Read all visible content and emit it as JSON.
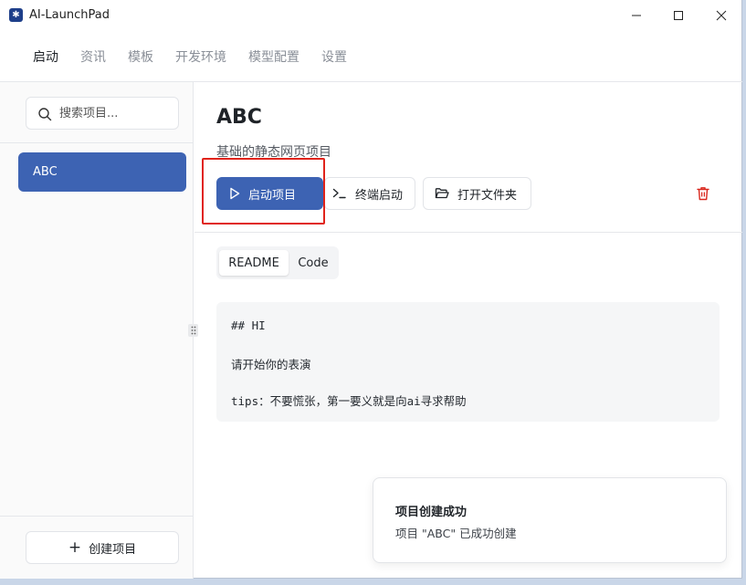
{
  "app": {
    "title": "AI-LaunchPad",
    "icon": "app-logo-icon"
  },
  "window_controls": [
    "minimize-icon",
    "maximize-icon",
    "close-icon"
  ],
  "menu": {
    "items": [
      {
        "label": "启动",
        "active": true
      },
      {
        "label": "资讯"
      },
      {
        "label": "模板"
      },
      {
        "label": "开发环境"
      },
      {
        "label": "模型配置"
      },
      {
        "label": "设置"
      }
    ]
  },
  "sidebar": {
    "search": {
      "placeholder": "搜索项目...",
      "value": "",
      "icon": "search-icon"
    },
    "projects": [
      {
        "name": "ABC",
        "selected": true
      }
    ],
    "create_label": "创建项目"
  },
  "project": {
    "name": "ABC",
    "description": "基础的静态网页项目",
    "actions": {
      "start_label": "启动项目",
      "terminal_label": "终端启动",
      "folder_label": "打开文件夹"
    },
    "tabs": [
      {
        "label": "README",
        "active": true
      },
      {
        "label": "Code"
      }
    ],
    "readme": [
      "## HI",
      "请开始你的表演",
      "tips：不要慌张，第一要义就是向ai寻求帮助"
    ]
  },
  "toast": {
    "title": "项目创建成功",
    "message": "项目 \"ABC\" 已成功创建"
  },
  "colors": {
    "primary": "#3d63b3",
    "highlight_border": "#e0231b",
    "delete": "#d9261c",
    "logo": "#1e3f8a"
  }
}
